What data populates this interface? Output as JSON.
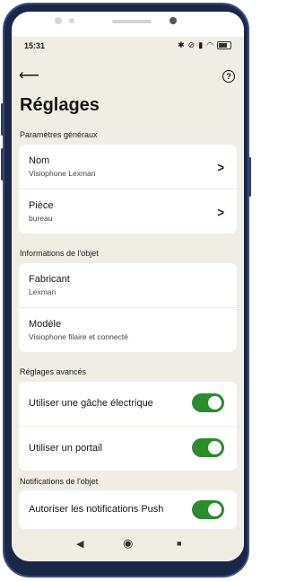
{
  "status_bar": {
    "time": "15:31",
    "icons": [
      "bluetooth-icon",
      "mute-icon",
      "signal-icon",
      "wifi-icon",
      "battery-icon"
    ]
  },
  "app_bar": {
    "back_icon": "arrow-left-icon",
    "help_icon": "help-circle-icon",
    "help_glyph": "?"
  },
  "page": {
    "title": "Réglages"
  },
  "sections": {
    "general": {
      "title": "Paramètres généraux",
      "rows": [
        {
          "label": "Nom",
          "value": "Visiophone Lexman"
        },
        {
          "label": "Pièce",
          "value": "bureau"
        }
      ]
    },
    "object_info": {
      "title": "Informations de l'objet",
      "rows": [
        {
          "label": "Fabricant",
          "value": "Lexman"
        },
        {
          "label": "Modèle",
          "value": "Visiophone filaire et connecté"
        }
      ]
    },
    "advanced": {
      "title": "Réglages avancés",
      "rows": [
        {
          "label": "Utiliser une gâche électrique",
          "enabled": true
        },
        {
          "label": "Utiliser un portail",
          "enabled": true
        }
      ]
    },
    "notifications": {
      "title": "Notifications de l'objet",
      "rows": [
        {
          "label": "Autoriser les notifications Push",
          "enabled": true
        }
      ]
    }
  },
  "nav_bar": {
    "back": "◀",
    "home": "◉",
    "recents": "■"
  },
  "colors": {
    "accent": "#2c8b2e",
    "background": "#f0ede4",
    "card": "#ffffff",
    "frame": "#1b2746"
  }
}
